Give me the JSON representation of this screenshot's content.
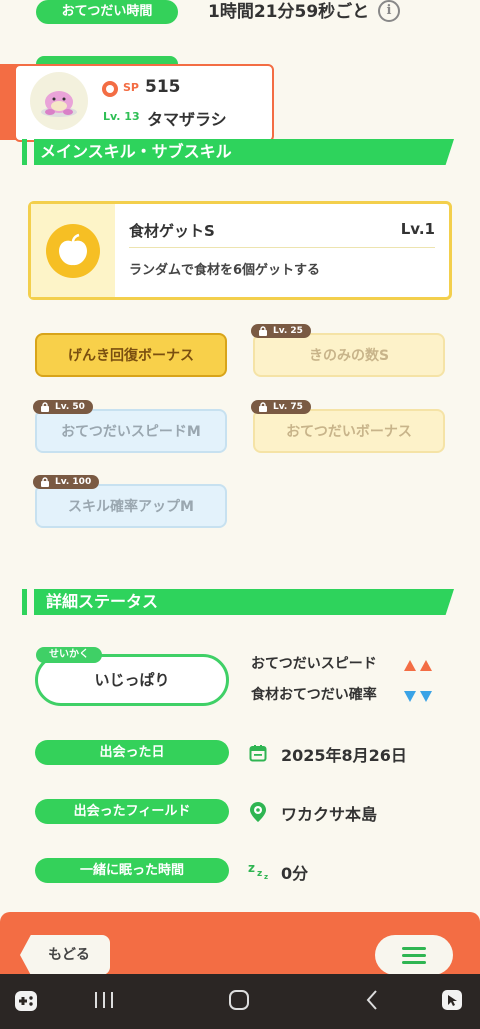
{
  "header": {
    "helper_time_label": "おてつだい時間",
    "helper_time_value": "1時間21分59秒ごと"
  },
  "pokemon_card": {
    "sp_label": "SP",
    "sp_value": "515",
    "level": "Lv. 13",
    "name": "タマザラシ",
    "accent_color": "#f36d44"
  },
  "skills_section": {
    "title": "メインスキル・サブスキル",
    "main_skill": {
      "name": "食材ゲットS",
      "level": "Lv.1",
      "description": "ランダムで食材を6個ゲットする",
      "icon": "apple-icon"
    },
    "sub_skills": [
      {
        "label": "げんき回復ボーナス",
        "lock": "",
        "style": "unlocked-gold"
      },
      {
        "label": "きのみの数S",
        "lock": "Lv. 25",
        "style": "locked-gold"
      },
      {
        "label": "おてつだいスピードM",
        "lock": "Lv. 50",
        "style": "locked-blue"
      },
      {
        "label": "おてつだいボーナス",
        "lock": "Lv. 75",
        "style": "locked-gold"
      },
      {
        "label": "スキル確率アップM",
        "lock": "Lv. 100",
        "style": "locked-blue"
      }
    ]
  },
  "details_section": {
    "title": "詳細ステータス",
    "nature_tag": "せいかく",
    "nature_value": "いじっぱり",
    "up_stat": "おてつだいスピード",
    "down_stat": "食材おてつだい確率",
    "rows": [
      {
        "label": "出会った日",
        "value": "2025年8月26日",
        "icon": "calendar-icon"
      },
      {
        "label": "出会ったフィールド",
        "value": "ワカクサ本島",
        "icon": "location-pin-icon"
      },
      {
        "label": "一緒に眠った時間",
        "value": "0分",
        "icon": "zzz-sleep-icon"
      }
    ]
  },
  "footer": {
    "back_label": "もどる",
    "menu_icon": "menu-icon"
  },
  "colors": {
    "green": "#34d15a",
    "gold": "#f6d24a",
    "blue_tint": "#dff0fa",
    "orange": "#f36d44"
  }
}
